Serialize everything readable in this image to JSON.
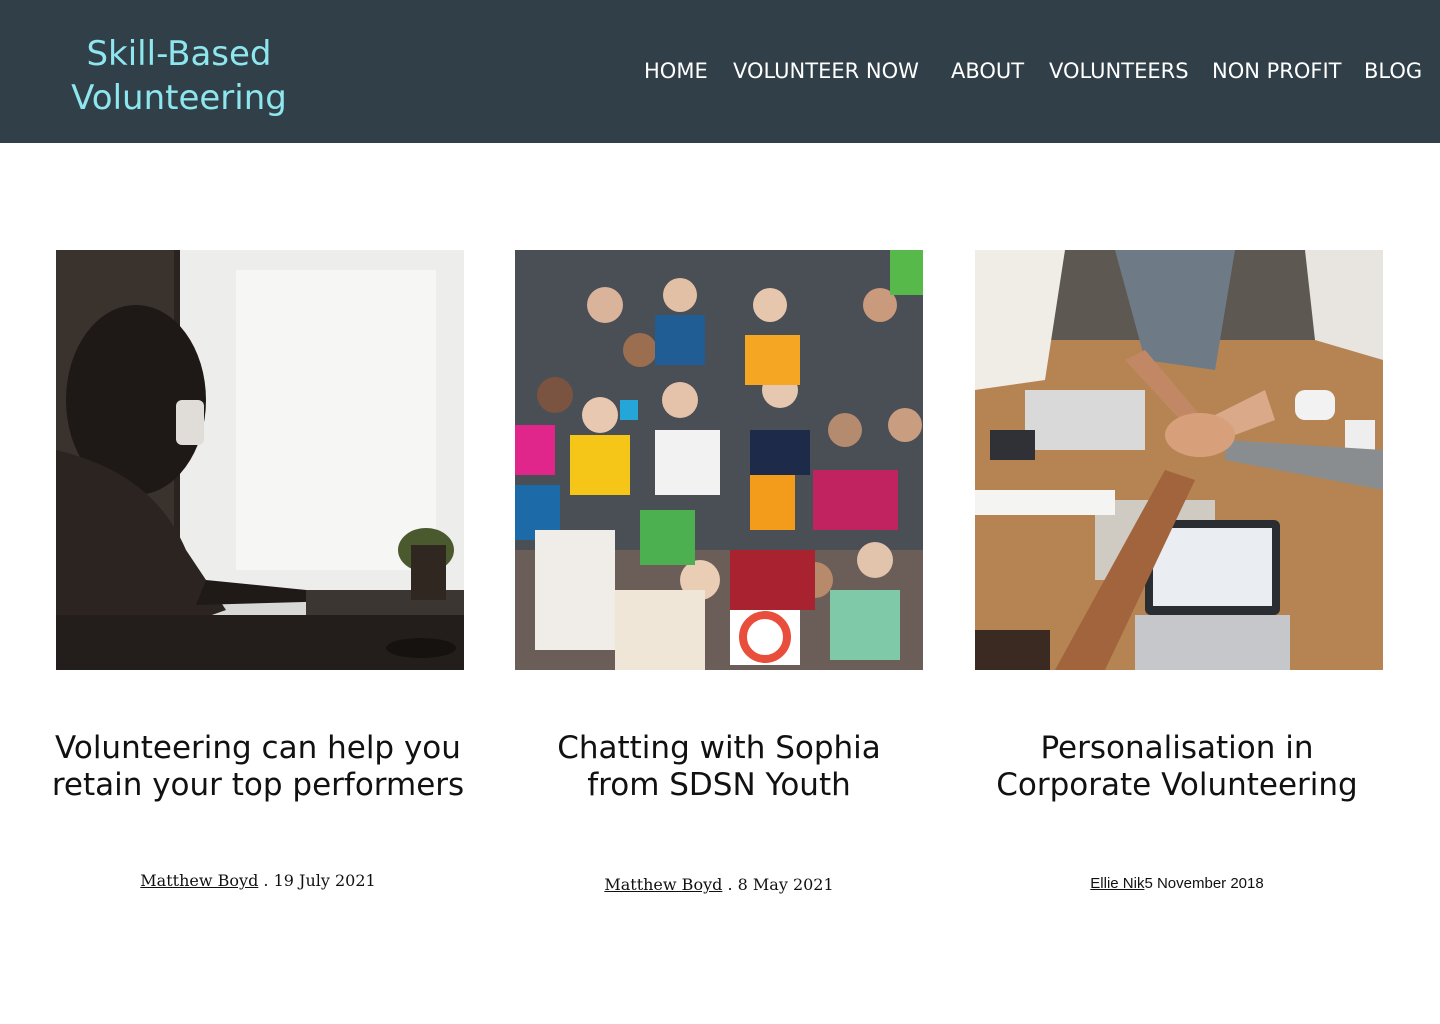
{
  "header": {
    "logo_line1": "Skill-Based",
    "logo_line2": "Volunteering",
    "bg_color": "#313f48",
    "logo_color": "#8ee6ee"
  },
  "nav": {
    "items": [
      {
        "label": "HOME"
      },
      {
        "label": "VOLUNTEER NOW"
      },
      {
        "label": "ABOUT"
      },
      {
        "label": "VOLUNTEERS"
      },
      {
        "label": "NON PROFIT"
      },
      {
        "label": "BLOG"
      }
    ]
  },
  "posts": [
    {
      "title_line1": "Volunteering can help you",
      "title_line2": "retain your top performers",
      "author": "Matthew Boyd",
      "separator": " . ",
      "date": "19 July 2021",
      "image": "woman-drinking-coffee-at-laptop-photo"
    },
    {
      "title_line1": "Chatting with Sophia",
      "title_line2": "from SDSN Youth",
      "author": "Matthew Boyd",
      "separator": " . ",
      "date": "8 May 2021",
      "image": "group-holding-sdg-signs-photo"
    },
    {
      "title_line1": "Personalisation in",
      "title_line2": "Corporate Volunteering",
      "author": "Ellie Nik",
      "separator": "",
      "date": "5 November 2018",
      "image": "team-hands-stacked-over-desk-photo"
    }
  ]
}
